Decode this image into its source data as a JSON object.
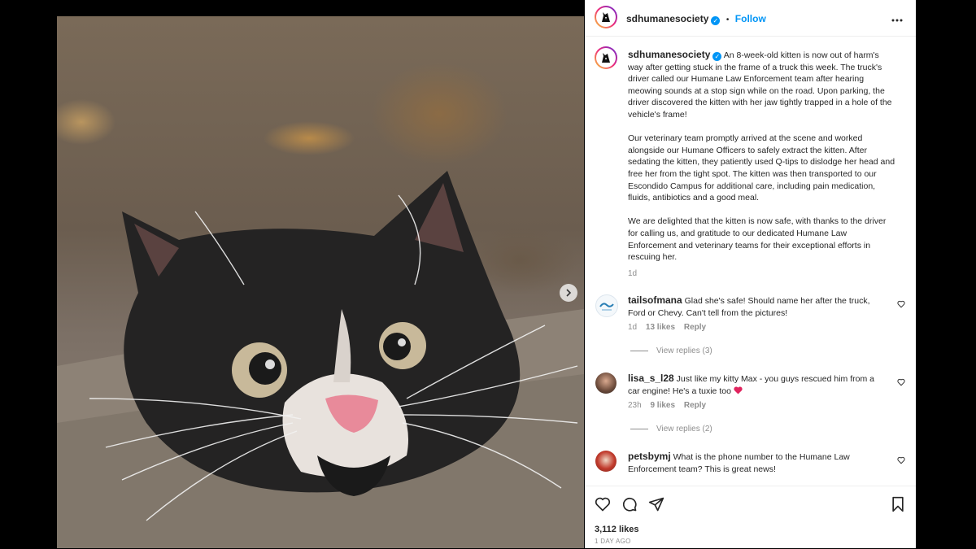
{
  "post": {
    "username": "sdhumanesociety",
    "follow_label": "Follow",
    "more_label": "•••",
    "caption_paragraphs": [
      "An 8-week-old kitten is now out of harm's way after getting stuck in the frame of a truck this week. The truck's driver called our Humane Law Enforcement team after hearing meowing sounds at a stop sign while on the road. Upon parking, the driver discovered the kitten with her jaw tightly trapped in a hole of the vehicle's frame!",
      "Our veterinary team promptly arrived at the scene and worked alongside our Humane Officers to safely extract the kitten. After sedating the kitten, they patiently used Q-tips to dislodge her head and free her from the tight spot. The kitten was then transported to our Escondido Campus for additional care, including pain medication, fluids, antibiotics and a good meal.",
      "We are delighted that the kitten is now safe, with thanks to the driver for calling us, and gratitude to our dedicated Humane Law Enforcement and veterinary teams for their exceptional efforts in rescuing her."
    ],
    "caption_time": "1d",
    "likes": "3,112 likes",
    "posted": "1 DAY AGO"
  },
  "comments": [
    {
      "username": "tailsofmana",
      "text": "Glad she's safe! Should name her after the truck, Ford or Chevy. Can't tell from the pictures!",
      "time": "1d",
      "likes": "13 likes",
      "reply_label": "Reply",
      "view_replies": "View replies (3)"
    },
    {
      "username": "lisa_s_l28",
      "text": "Just like my kitty Max - you guys rescued him from a car engine! He's a tuxie too",
      "time": "23h",
      "likes": "9 likes",
      "reply_label": "Reply",
      "view_replies": "View replies (2)"
    },
    {
      "username": "petsbymj",
      "text": "What is the phone number to the Humane Law Enforcement team? This is great news!",
      "time": "",
      "likes": "",
      "reply_label": ""
    }
  ],
  "icons": {
    "like": "heart-icon",
    "comment": "comment-icon",
    "share": "share-icon",
    "save": "bookmark-icon",
    "next": "chevron-right-icon"
  },
  "colors": {
    "accent": "#0095f6",
    "muted": "#8e8e8e",
    "heart": "#ed4956"
  }
}
